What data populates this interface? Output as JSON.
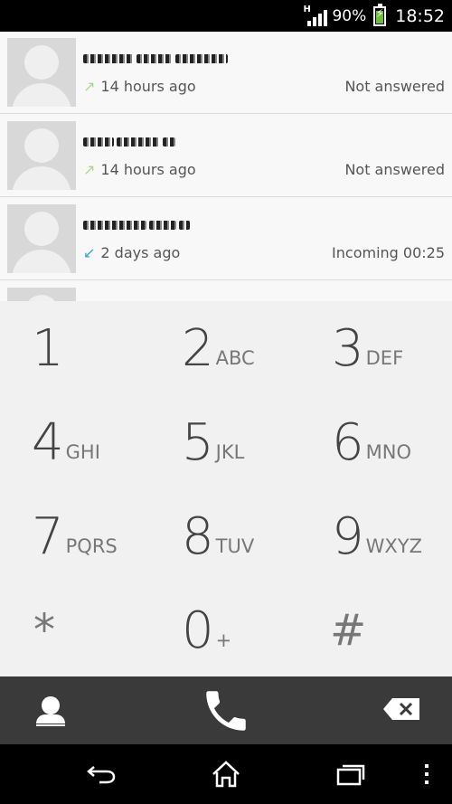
{
  "status_bar": {
    "network": "H",
    "battery_pct": "90%",
    "time": "18:52"
  },
  "call_log": [
    {
      "time_ago": "14 hours ago",
      "direction": "outgoing",
      "status": "Not answered"
    },
    {
      "time_ago": "14 hours ago",
      "direction": "outgoing",
      "status": "Not answered"
    },
    {
      "time_ago": "2 days ago",
      "direction": "incoming",
      "status": "Incoming 00:25"
    }
  ],
  "dialpad": [
    {
      "digit": "1",
      "letters": ""
    },
    {
      "digit": "2",
      "letters": "ABC"
    },
    {
      "digit": "3",
      "letters": "DEF"
    },
    {
      "digit": "4",
      "letters": "GHI"
    },
    {
      "digit": "5",
      "letters": "JKL"
    },
    {
      "digit": "6",
      "letters": "MNO"
    },
    {
      "digit": "7",
      "letters": "PQRS"
    },
    {
      "digit": "8",
      "letters": "TUV"
    },
    {
      "digit": "9",
      "letters": "WXYZ"
    },
    {
      "digit": "*",
      "letters": ""
    },
    {
      "digit": "0",
      "letters": "+"
    },
    {
      "digit": "#",
      "letters": ""
    }
  ],
  "icons": {
    "outgoing_arrow": "↗",
    "incoming_arrow": "↙",
    "contacts": "person-icon",
    "call": "phone-icon",
    "backspace": "backspace-icon",
    "back": "back-icon",
    "home": "home-icon",
    "recents": "recent-apps-icon",
    "menu": "more-vert-icon"
  },
  "colors": {
    "outgoing_arrow": "#a8d98a",
    "incoming_arrow": "#33a5d8",
    "battery": "#6bbf3a",
    "action_bar": "#3a3a3a"
  }
}
